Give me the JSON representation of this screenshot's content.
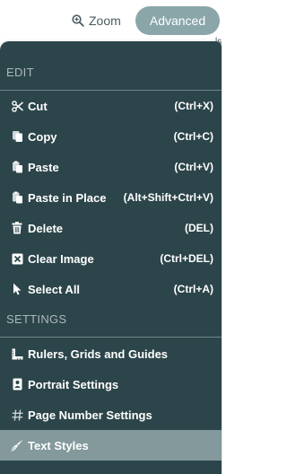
{
  "toolbar": {
    "zoom_label": "Zoom",
    "advanced_label": "Advanced",
    "edge_glyph": "ls"
  },
  "menu": {
    "edit_header": "EDIT",
    "settings_header": "SETTINGS",
    "edit_items": [
      {
        "icon": "scissors-icon",
        "label": "Cut",
        "shortcut": "(Ctrl+X)"
      },
      {
        "icon": "copy-icon",
        "label": "Copy",
        "shortcut": "(Ctrl+C)"
      },
      {
        "icon": "paste-icon",
        "label": "Paste",
        "shortcut": "(Ctrl+V)"
      },
      {
        "icon": "paste-in-place-icon",
        "label": "Paste in Place",
        "shortcut": "(Alt+Shift+Ctrl+V)"
      },
      {
        "icon": "trash-icon",
        "label": "Delete",
        "shortcut": "(DEL)"
      },
      {
        "icon": "clear-image-icon",
        "label": "Clear Image",
        "shortcut": "(Ctrl+DEL)"
      },
      {
        "icon": "cursor-icon",
        "label": "Select All",
        "shortcut": "(Ctrl+A)"
      }
    ],
    "settings_items": [
      {
        "icon": "ruler-icon",
        "label": "Rulers, Grids and Guides"
      },
      {
        "icon": "portrait-icon",
        "label": "Portrait Settings"
      },
      {
        "icon": "hash-icon",
        "label": "Page Number Settings"
      },
      {
        "icon": "text-styles-icon",
        "label": "Text Styles",
        "active": true
      }
    ]
  },
  "colors": {
    "menu_background": "#2c454a",
    "active_item": "#83999c",
    "advanced_button": "#8aa6a9"
  }
}
